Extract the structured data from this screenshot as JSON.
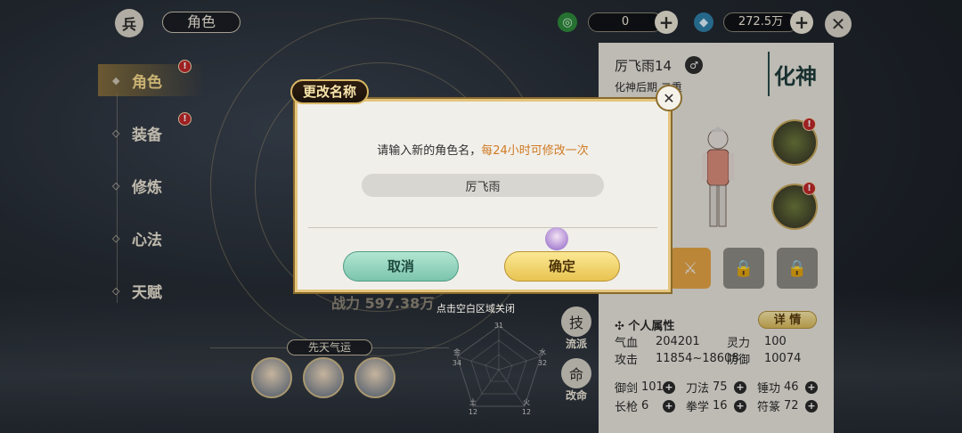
{
  "header": {
    "title": "角色",
    "currency1": "0",
    "currency2": "272.5万"
  },
  "menu": {
    "items": [
      {
        "label": "角色"
      },
      {
        "label": "装备"
      },
      {
        "label": "修炼"
      },
      {
        "label": "心法"
      },
      {
        "label": "天赋"
      }
    ],
    "badge": "!"
  },
  "power": "战力 597.38万",
  "close_hint": "点击空白区域关闭",
  "fate": {
    "title": "先天气运"
  },
  "side_buttons": [
    {
      "label": "流派",
      "icon": "技"
    },
    {
      "label": "改命",
      "icon": "命"
    }
  ],
  "radar": {
    "top": "31",
    "right": "32",
    "bottom_right": "12",
    "bottom_left": "12",
    "left": "34",
    "labels": [
      "金",
      "水",
      "火",
      "土"
    ]
  },
  "panel": {
    "name": "厉飞雨14",
    "realm": "化神后期 二重",
    "seal": "化神",
    "attr_header": "✣ 个人属性",
    "detail_button": "详 情",
    "stats": [
      {
        "k1": "气血",
        "v1": "204201",
        "k2": "灵力",
        "v2": "100"
      },
      {
        "k1": "攻击",
        "v1": "11854~18608",
        "k2": "防御",
        "v2": "10074"
      }
    ],
    "skills": [
      [
        {
          "name": "御剑",
          "value": "101"
        },
        {
          "name": "刀法",
          "value": "75"
        },
        {
          "name": "锤功",
          "value": "46"
        }
      ],
      [
        {
          "name": "长枪",
          "value": "6"
        },
        {
          "name": "拳学",
          "value": "16"
        },
        {
          "name": "符篆",
          "value": "72"
        }
      ]
    ]
  },
  "dialog": {
    "title": "更改名称",
    "prompt_main": "请输入新的角色名，",
    "prompt_warn": "每24小时可修改一次",
    "input_value": "厉飞雨",
    "cancel_label": "取消",
    "confirm_label": "确定"
  },
  "colors": {
    "accent_gold": "#e4c57d",
    "warn_orange": "#cf7a22",
    "cancel_teal": "#7cc4ad",
    "confirm_yellow": "#e8c351"
  }
}
